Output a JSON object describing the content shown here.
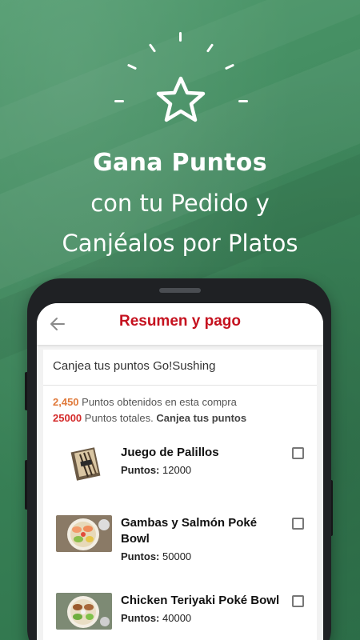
{
  "promo": {
    "headline": "Gana Puntos",
    "line2": "con tu  Pedido y",
    "line3": "Canjéalos por Platos"
  },
  "app": {
    "title": "Resumen y pago",
    "back_icon": "arrow-left-icon",
    "section_title": "Canjea tus puntos Go!Sushing",
    "points_earned_value": "2,450",
    "points_earned_label": " Puntos obtenidos en esta compra",
    "points_total_value": "25000",
    "points_total_label": " Puntos totales. ",
    "redeem_link": "Canjea tus puntos",
    "points_prefix": "Puntos:",
    "items": [
      {
        "name": "Juego de Palillos",
        "points": " 12000",
        "checked": false
      },
      {
        "name": "Gambas y Salmón Poké Bowl",
        "points": " 50000",
        "checked": false
      },
      {
        "name": "Chicken Teriyaki Poké Bowl",
        "points": " 40000",
        "checked": false
      }
    ]
  },
  "colors": {
    "background_green": "#3f8a5e",
    "title_red": "#c5121f",
    "earned_orange": "#e07a3b",
    "total_red": "#d42a2a"
  }
}
